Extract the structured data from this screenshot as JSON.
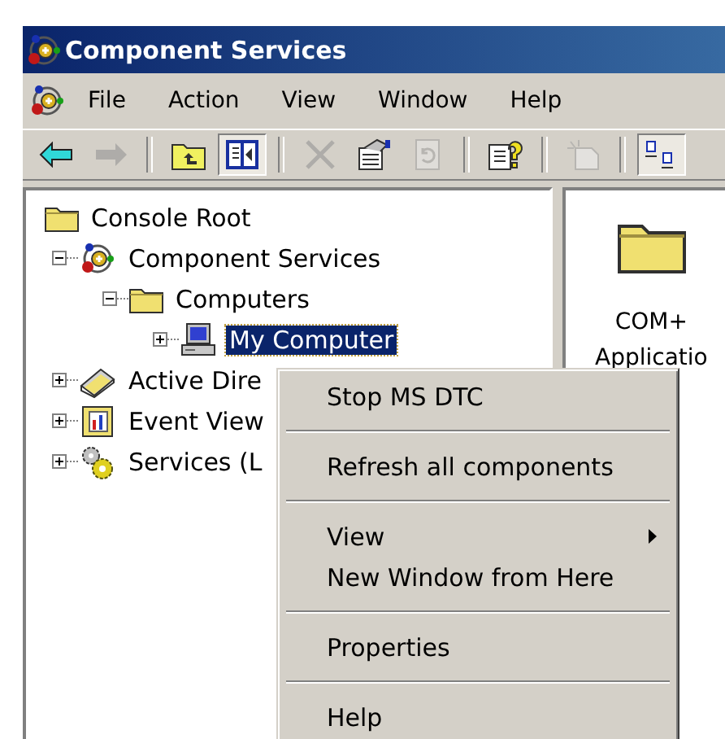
{
  "window": {
    "title": "Component Services"
  },
  "menu_bar": [
    "File",
    "Action",
    "View",
    "Window",
    "Help"
  ],
  "toolbar": [
    {
      "kind": "back",
      "disabled": false,
      "pressed": false
    },
    {
      "kind": "forward",
      "disabled": true,
      "pressed": false
    },
    {
      "kind": "sep"
    },
    {
      "kind": "up",
      "disabled": false,
      "pressed": false
    },
    {
      "kind": "tree",
      "disabled": false,
      "pressed": true
    },
    {
      "kind": "sep"
    },
    {
      "kind": "delete",
      "disabled": true,
      "pressed": false
    },
    {
      "kind": "properties",
      "disabled": false,
      "pressed": false
    },
    {
      "kind": "refresh",
      "disabled": true,
      "pressed": false
    },
    {
      "kind": "sep"
    },
    {
      "kind": "help",
      "disabled": false,
      "pressed": false
    },
    {
      "kind": "sep"
    },
    {
      "kind": "newwindow",
      "disabled": true,
      "pressed": false
    },
    {
      "kind": "sep"
    },
    {
      "kind": "list",
      "disabled": false,
      "pressed": true
    }
  ],
  "tree": {
    "label": "Console Root",
    "kind": "folder",
    "selected": false,
    "children": [
      {
        "label": "Component Services",
        "kind": "com",
        "expanded": true,
        "selected": false,
        "children": [
          {
            "label": "Computers",
            "kind": "folder",
            "expanded": true,
            "selected": false,
            "children": [
              {
                "label": "My Computer",
                "kind": "computer",
                "expanded": false,
                "selected": true
              }
            ]
          }
        ]
      },
      {
        "label": "Active Dire",
        "kind": "directory",
        "expanded": false,
        "selected": false
      },
      {
        "label": "Event View",
        "kind": "event",
        "expanded": false,
        "selected": false
      },
      {
        "label": "Services (L",
        "kind": "services",
        "expanded": false,
        "selected": false
      }
    ]
  },
  "details": [
    {
      "lines": [
        "COM+",
        "Applicatio"
      ]
    }
  ],
  "context_menu": [
    {
      "kind": "item",
      "label": "Stop MS DTC"
    },
    {
      "kind": "separator"
    },
    {
      "kind": "item",
      "label": "Refresh all components"
    },
    {
      "kind": "separator"
    },
    {
      "kind": "submenu",
      "label": "View"
    },
    {
      "kind": "item",
      "label": "New Window from Here"
    },
    {
      "kind": "separator"
    },
    {
      "kind": "item",
      "label": "Properties"
    },
    {
      "kind": "separator"
    },
    {
      "kind": "item",
      "label": "Help"
    }
  ]
}
